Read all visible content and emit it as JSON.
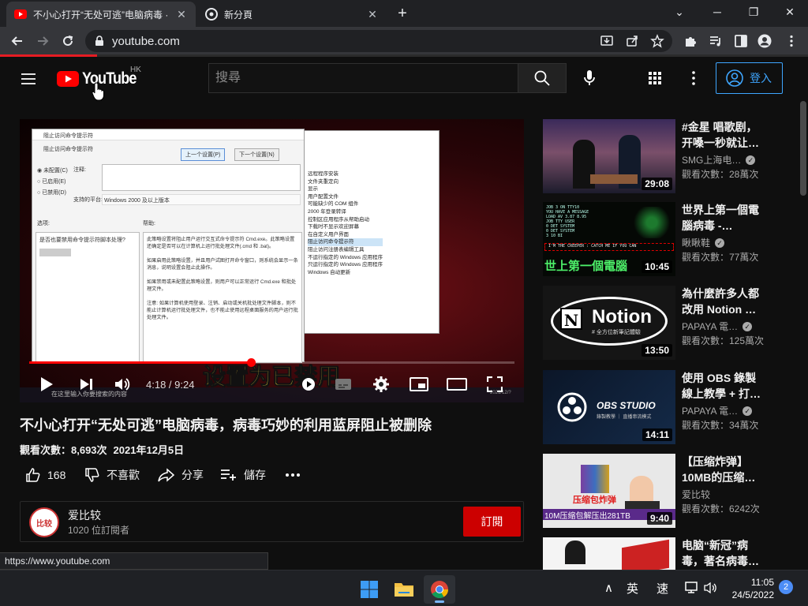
{
  "browser": {
    "tabs": [
      {
        "title": "不小心打开“无处可逃”电脑病毒 · ",
        "active": true
      },
      {
        "title": "新分頁",
        "active": false
      }
    ],
    "url": "youtube.com",
    "status_url": "https://www.youtube.com",
    "loading_progress": 0.12,
    "accent_color": "#e51c23"
  },
  "youtube": {
    "logo_text": "YouTube",
    "region": "HK",
    "search_placeholder": "搜尋",
    "signin_label": "登入",
    "brand_color": "#ff0000"
  },
  "player": {
    "subtitle": "设置为已禁用",
    "time": "4:18 / 9:24",
    "progress": 0.457,
    "dialog": {
      "title": "阻止访问命令提示符",
      "subtitle": "阻止访问命令提示符",
      "prev_btn": "上一个设置(P)",
      "next_btn": "下一个设置(N)",
      "radio_1": "未配置(C)",
      "radio_2": "已启用(E)",
      "radio_3": "已禁用(D)",
      "comment_label": "注释:",
      "supported_label": "支持的平台:",
      "supported_value": "Windows 2000 及以上版本",
      "options_label": "选项:",
      "help_label": "帮助:",
      "option_text": "是否也要禁用命令提示符脚本处理?",
      "help_text_1": "此策略设置将阻止用户运行交互式命令提示符 Cmd.exe。此策略设置还确定是否可以在计算机上运行批处理文件(.cmd 和 .bat)。",
      "help_text_2": "如果启用此策略设置，并且用户试图打开命令窗口，则系统会显示一条消息，说明设置会阻止此操作。",
      "help_text_3": "如果禁用或未配置此策略设置，则用户可以正常运行 Cmd.exe 和批处理文件。",
      "help_text_4": "注意: 如果计算机使用登录、注销、启动或关机批处理文件脚本，则不能止计算机运行批处理文件，也不能止使用远程桌面服务的用户运行批处理文件。"
    },
    "bg_list": [
      "远程程序安装",
      "文件夹重定向",
      "显示",
      "用户配置文件",
      "可能缺少的 COM 组件",
      "2000 年登录转译",
      "控制区应用程序从帮助启动",
      "下载时不显示欢迎屏幕",
      "在自定义用户界面",
      "阻止访问命令提示符",
      "阻止访问注册表编辑工具",
      "不运行指定的 Windows 应用程序",
      "只运行指定的 Windows 应用程序",
      "Windows 自动更新"
    ],
    "video_taskbar_search": "在这里输入你要搜索的内容",
    "video_clock": "2021/12/?"
  },
  "video": {
    "title": "不小心打开“无处可逃”电脑病毒，病毒巧妙的利用蓝屏阻止被删除",
    "views": "觀看次數：8,693次",
    "date": "2021年12月5日",
    "likes": "168",
    "dislike_label": "不喜歡",
    "share_label": "分享",
    "save_label": "儲存"
  },
  "channel": {
    "name": "爱比较",
    "avatar_text": "比较",
    "subscribers": "1020 位訂閱者",
    "subscribe_label": "訂閱"
  },
  "recommendations": [
    {
      "title": "#金星 唱歌剧，开嗓一秒就让…",
      "channel": "SMG上海电…",
      "verified": true,
      "views": "觀看次數：28萬次",
      "duration": "29:08"
    },
    {
      "title": "世界上第一個電腦病毒 -…",
      "channel": "瞅瞅鞋",
      "verified": true,
      "views": "觀看次數：77萬次",
      "duration": "10:45",
      "thumb_caption": "世上第一個電腦",
      "thumb_term": "I'M THE CREEPER : CATCH ME IF YOU CAN"
    },
    {
      "title": "為什麼許多人都改用 Notion …",
      "channel": "PAPAYA 電…",
      "verified": true,
      "views": "觀看次數：125萬次",
      "duration": "13:50",
      "thumb_brand": "Notion",
      "thumb_sub": "# 全方位新筆記體驗"
    },
    {
      "title": "使用 OBS 錄製線上教學 + 打…",
      "channel": "PAPAYA 電…",
      "verified": true,
      "views": "觀看次數：34萬次",
      "duration": "14:11",
      "thumb_brand": "OBS STUDIO",
      "thumb_sub": "錄製教學 ｜ 直播串流模式"
    },
    {
      "title": "【压缩炸弹】10MB的压缩…",
      "channel": "爱比较",
      "verified": false,
      "views": "觀看次數：6242次",
      "duration": "9:40",
      "thumb_caption": "压缩包炸弹",
      "thumb_caption2": "10M压缩包解压出281TB"
    },
    {
      "title": "电脑“新冠”病毒，著名病毒…",
      "channel": "",
      "verified": false,
      "views": "",
      "duration": ""
    }
  ],
  "taskbar": {
    "ime_1": "英",
    "ime_2": "速",
    "time": "11:05",
    "date": "24/5/2022",
    "badge": "2"
  }
}
